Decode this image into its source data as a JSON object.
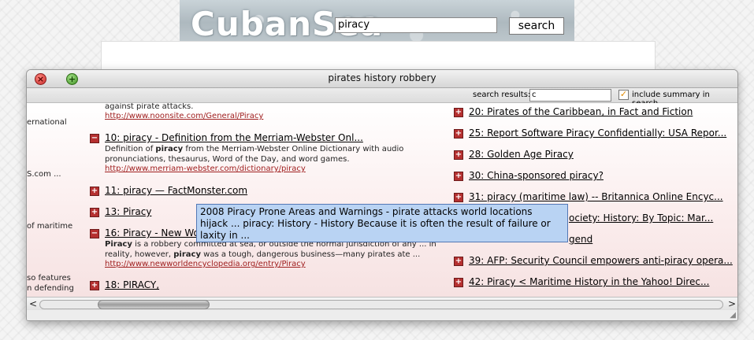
{
  "header": {
    "logo": "CubanSea",
    "search_value": "piracy",
    "search_button": "search"
  },
  "window": {
    "title": "pirates history robbery",
    "close_icon": "close-icon",
    "zoom_icon": "zoom-icon",
    "search_results_label": "search results:",
    "search_results_value": "c",
    "include_summary_label": "include summary in search",
    "include_summary_checked": true
  },
  "left_fragments": [
    "ernational",
    "S.com ...",
    "of maritime",
    "so features",
    "n defending"
  ],
  "left_results": {
    "r0": {
      "snippet": "against pirate attacks.",
      "url": "http://www.noonsite.com/General/Piracy"
    },
    "r10": {
      "title": "10: piracy - Definition from the Merriam-Webster Onl...",
      "snippet1_a": "Definition of ",
      "snippet1_b": "piracy",
      "snippet1_c": " from the Merriam-Webster Online Dictionary with audio",
      "snippet2_a": "pronunciations, thesaurus, ",
      "snippet2_b": "Word of the Day",
      "snippet2_c": ", and word games.",
      "url": "http://www.merriam-webster.com/dictionary/piracy"
    },
    "r11": {
      "title": "11: piracy — FactMonster.com"
    },
    "r13": {
      "title": "13: Piracy"
    },
    "r16": {
      "title": "16: Piracy - New Wo",
      "snippet1_a": "Piracy",
      "snippet1_b": " is a robbery committed at sea, or outside the normal jurisdiction of any ... in",
      "snippet2_a": "reality, however, ",
      "snippet2_b": "piracy",
      "snippet2_c": " was a tough, dangerous business—many pirates ate ...",
      "url": "http://www.newworldencyclopedia.org/entry/Piracy"
    },
    "r18": {
      "title": "18: PIRACY,"
    }
  },
  "right_results": [
    "20: Pirates of the Caribbean, in Fact and Fiction",
    "25: Report Software Piracy Confidentially: USA Repor...",
    "28: Golden Age Piracy",
    "30: China-sponsored piracy?",
    "31: piracy (maritime law) -- Britannica Online Encyc...",
    "ociety: History: By Topic: Mar...",
    "gend",
    "39: AFP: Security Council empowers anti-piracy opera...",
    "42: Piracy < Maritime History in the Yahoo! Direc..."
  ],
  "tooltip": {
    "line1": "2008 Piracy Prone Areas and Warnings - pirate attacks world locations",
    "line2": "hijack ... piracy: History - History Because it is often the result of failure or",
    "line3": "laxity in ..."
  },
  "scrollbar": {
    "left_arrow": "<",
    "right_arrow": ">"
  }
}
